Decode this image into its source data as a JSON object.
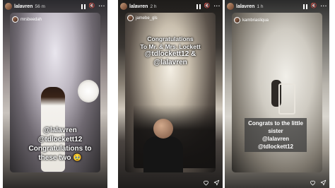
{
  "stories": [
    {
      "username": "lalavren",
      "time": "56 m",
      "tagged_account": "mrsbeedah",
      "caption_lines": [
        "@lalavren",
        "@tdlockett12",
        "Congratulations to",
        "these two 🥹"
      ]
    },
    {
      "username": "lalavren",
      "time": "2 h",
      "tagged_account": "jamebe_gls",
      "caption_lines": [
        "Congratulations",
        "To Mr. & Mrs. Lockett",
        "@tdlockett12 & @lalavren"
      ]
    },
    {
      "username": "lalavren",
      "time": "1 h",
      "tagged_account": "kambriasliqua",
      "caption_lines": [
        "Congrats to the little sister",
        "@lalavren @tdlockett12"
      ]
    }
  ],
  "icons": {
    "pause": "pause-icon",
    "mute": "speaker-muted-icon",
    "more": "more-dots-icon",
    "like": "heart-icon",
    "share": "send-icon"
  }
}
